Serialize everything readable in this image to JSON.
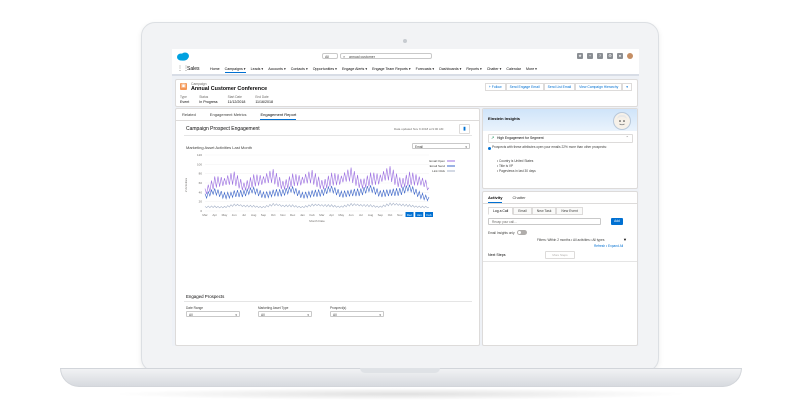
{
  "search": {
    "scope": "All",
    "query": "annual customer"
  },
  "nav": {
    "app_name": "Sales",
    "items": [
      {
        "label": "Home",
        "active": false
      },
      {
        "label": "Campaigns",
        "active": true
      },
      {
        "label": "Leads",
        "active": false
      },
      {
        "label": "Accounts",
        "active": false
      },
      {
        "label": "Contacts",
        "active": false
      },
      {
        "label": "Opportunities",
        "active": false
      },
      {
        "label": "Engage Alerts",
        "active": false
      },
      {
        "label": "Engage Team Reports",
        "active": false
      },
      {
        "label": "Forecasts",
        "active": false
      },
      {
        "label": "Dashboards",
        "active": false
      },
      {
        "label": "Reports",
        "active": false
      },
      {
        "label": "Chatter",
        "active": false
      },
      {
        "label": "Calendar",
        "active": false
      },
      {
        "label": "More",
        "active": false
      }
    ]
  },
  "record": {
    "kind": "Campaign",
    "title": "Annual Customer Conference",
    "actions": [
      "+ Follow",
      "Send Engage Email",
      "Send List Email",
      "View Campaign Hierarchy"
    ],
    "fields": [
      {
        "label": "Type",
        "value": "Event"
      },
      {
        "label": "Status",
        "value": "In Progress"
      },
      {
        "label": "Start Date",
        "value": "11/12/2018"
      },
      {
        "label": "End Date",
        "value": "11/16/2018"
      }
    ]
  },
  "main": {
    "tabs": [
      {
        "label": "Related",
        "active": false
      },
      {
        "label": "Engagement Metrics",
        "active": false
      },
      {
        "label": "Engagement Report",
        "active": true
      }
    ],
    "card_title": "Campaign Prospect Engagement",
    "updated_text": "Data updated Nov 9 2018 at 9:00 AM",
    "chart_title": "Marketing Asset Activities Last Month",
    "chart_filter": "Email",
    "engaged_title": "Engaged Prospects",
    "filters": [
      {
        "label": "Date Range",
        "value": "All"
      },
      {
        "label": "Marketing Asset Type",
        "value": "All"
      },
      {
        "label": "Prospect(s)",
        "value": "All"
      }
    ]
  },
  "chart_data": {
    "type": "line",
    "xlabel": "Month Date",
    "ylabel": "# Activities",
    "ylim": [
      0,
      120
    ],
    "yticks": [
      0,
      20,
      40,
      60,
      80,
      100,
      120
    ],
    "categories": [
      "Mar",
      "Apr",
      "May",
      "Jun",
      "Jul",
      "Aug",
      "Sep",
      "Oct",
      "Nov",
      "Dec",
      "Jan",
      "Feb",
      "Mar",
      "Apr",
      "May",
      "Jun",
      "Jul",
      "Aug",
      "Sep",
      "Oct",
      "Nov",
      "Dec",
      "Jan",
      "Feb"
    ],
    "series": [
      {
        "name": "Email Open",
        "color": "#9b6fe0",
        "values": [
          48,
          62,
          55,
          70,
          60,
          66,
          58,
          74,
          63,
          68,
          57,
          72,
          64,
          70,
          59,
          76,
          66,
          71,
          61,
          78,
          68,
          73,
          58,
          50
        ]
      },
      {
        "name": "Email Send",
        "color": "#3a64c8",
        "values": [
          30,
          38,
          34,
          42,
          36,
          40,
          35,
          44,
          38,
          41,
          34,
          43,
          38,
          42,
          36,
          45,
          40,
          43,
          37,
          46,
          41,
          44,
          35,
          30
        ]
      },
      {
        "name": "Link Click",
        "color": "#a7b3c9",
        "values": [
          8,
          10,
          9,
          12,
          10,
          11,
          9,
          13,
          10,
          12,
          9,
          12,
          11,
          12,
          10,
          13,
          11,
          12,
          10,
          14,
          12,
          12,
          10,
          8
        ]
      }
    ],
    "highlight_categories": [
      "Dec",
      "Jan",
      "Feb"
    ],
    "legend_position": "right"
  },
  "einstein": {
    "title": "Einstein Insights",
    "chip": "High Engagement for Segment",
    "insight": "Prospects with these attributes open your emails 22% more than other prospects:",
    "bullets": [
      "Country is United States",
      "Title is VP",
      "Pageviews in last 30 days"
    ]
  },
  "activity": {
    "tabs": [
      {
        "label": "Activity",
        "active": true
      },
      {
        "label": "Chatter",
        "active": false
      }
    ],
    "subtabs": [
      {
        "label": "Log a Call",
        "active": true
      },
      {
        "label": "Email",
        "active": false
      },
      {
        "label": "New Task",
        "active": false
      },
      {
        "label": "New Event",
        "active": false
      }
    ],
    "recap_placeholder": "Recap your call...",
    "add_label": "Add",
    "email_only_label": "Email Insights only",
    "filters_text": "Filters: Within 2 months • All activities • All types",
    "links": "Refresh • Expand All",
    "next_steps": "Next Steps",
    "more_steps": "More Steps"
  }
}
